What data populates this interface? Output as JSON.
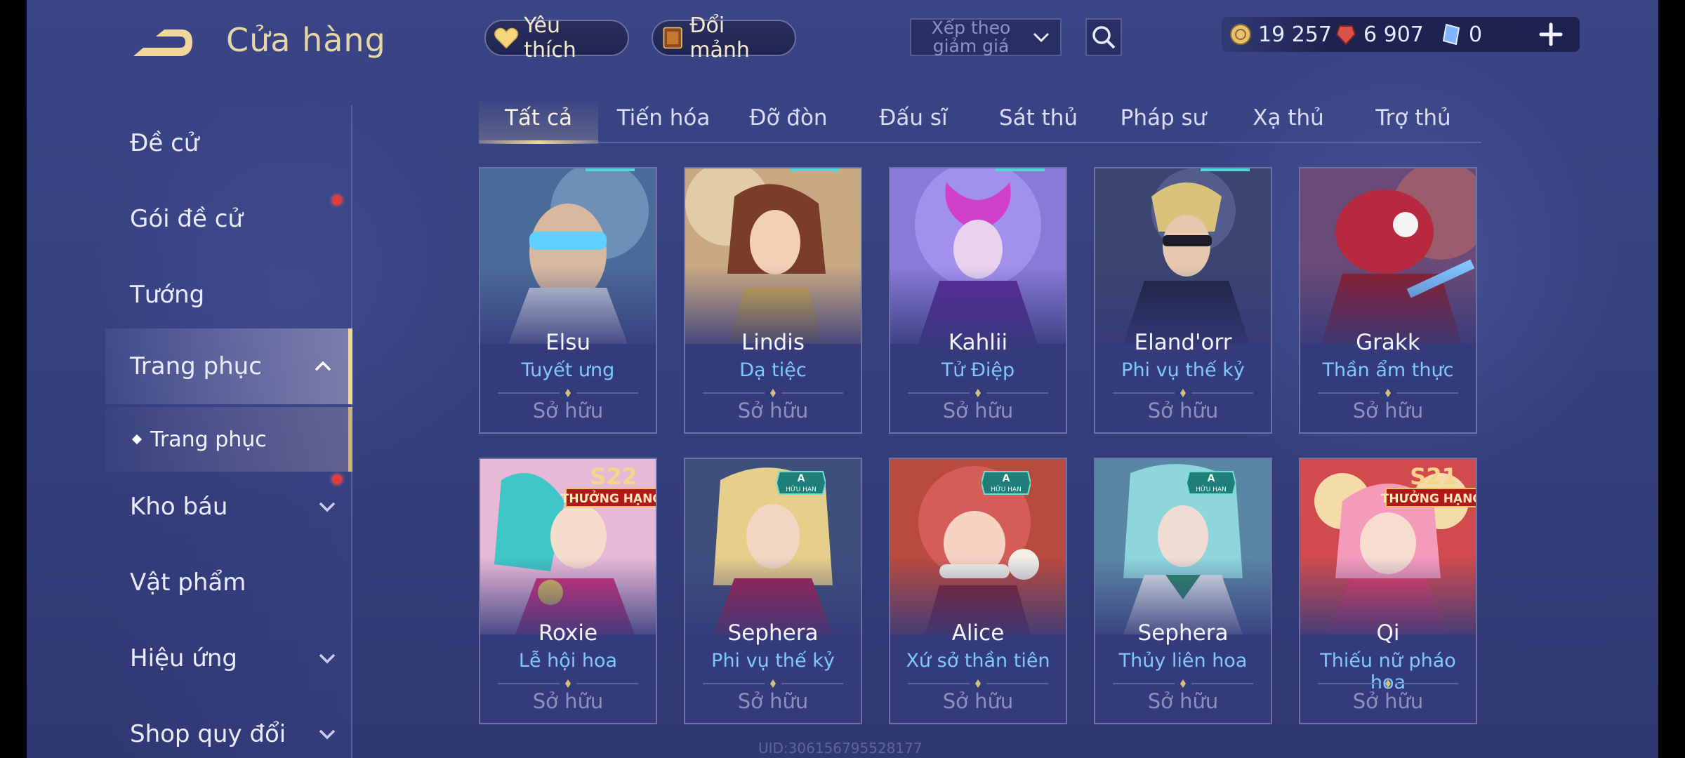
{
  "header": {
    "title": "Cửa hàng",
    "favorite_label": "Yêu thích",
    "exchange_label": "Đổi mảnh",
    "sort_label": "Xếp theo giảm giá",
    "currencies": {
      "gold": "19 257",
      "voucher": "6 907",
      "crystal": "0"
    }
  },
  "sidebar": {
    "items": [
      {
        "label": "Đề cử"
      },
      {
        "label": "Gói đề cử"
      },
      {
        "label": "Tướng"
      },
      {
        "label": "Trang phục"
      },
      {
        "label": "Trang phục"
      },
      {
        "label": "Kho báu"
      },
      {
        "label": "Vật phẩm"
      },
      {
        "label": "Hiệu ứng"
      },
      {
        "label": "Shop quy đổi"
      }
    ]
  },
  "tabs": [
    "Tất cả",
    "Tiến hóa",
    "Đỡ đòn",
    "Đấu sĩ",
    "Sát thủ",
    "Pháp sư",
    "Xạ thủ",
    "Trợ thủ"
  ],
  "cards": [
    {
      "hero": "Elsu",
      "skin": "Tuyết ưng",
      "status": "Sở hữu"
    },
    {
      "hero": "Lindis",
      "skin": "Dạ tiệc",
      "status": "Sở hữu"
    },
    {
      "hero": "Kahlii",
      "skin": "Tử Điệp",
      "status": "Sở hữu"
    },
    {
      "hero": "Eland'orr",
      "skin": "Phi vụ thế kỷ",
      "status": "Sở hữu"
    },
    {
      "hero": "Grakk",
      "skin": "Thần ẩm thực",
      "status": "Sở hữu"
    },
    {
      "hero": "Roxie",
      "skin": "Lễ hội hoa",
      "status": "Sở hữu",
      "badge": "S22",
      "badge_sub": "THƯỞNG HẠNG"
    },
    {
      "hero": "Sephera",
      "skin": "Phi vụ thế kỷ",
      "status": "Sở hữu",
      "badge": "A",
      "badge_sub": "HỮU HẠN"
    },
    {
      "hero": "Alice",
      "skin": "Xứ sở thần tiên",
      "status": "Sở hữu",
      "badge": "A",
      "badge_sub": "HỮU HẠN"
    },
    {
      "hero": "Sephera",
      "skin": "Thủy liên hoa",
      "status": "Sở hữu",
      "badge": "A",
      "badge_sub": "HỮU HẠN"
    },
    {
      "hero": "Qi",
      "skin": "Thiếu nữ pháo hoa",
      "status": "Sở hữu",
      "badge": "S21",
      "badge_sub": "THƯỞNG HẠNG"
    }
  ],
  "uid": "UID:306156795528177",
  "colors": {
    "accent_gold": "#f0d79c",
    "skin_name": "#7fc8ff",
    "notice_dot": "#e33a3a"
  }
}
